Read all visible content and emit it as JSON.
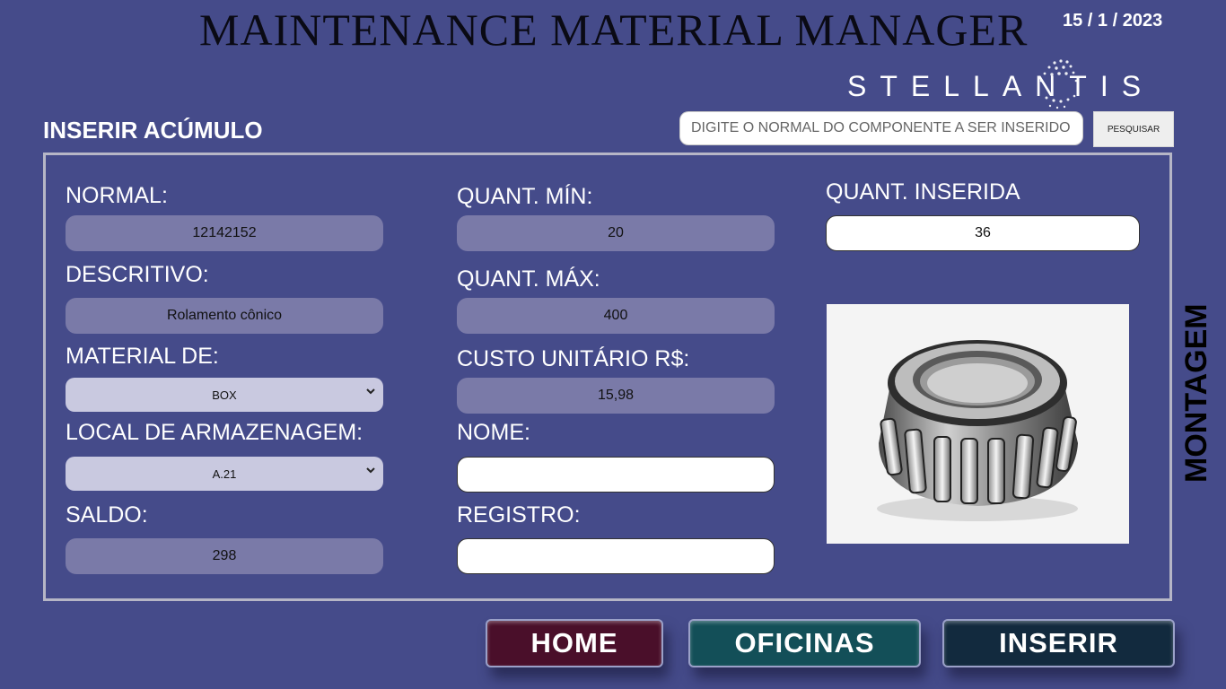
{
  "header": {
    "title": "MAINTENANCE MATERIAL MANAGER",
    "date": "15 / 1 / 2023",
    "logo_text": "STELLANTIS"
  },
  "section_title": "INSERIR ACÚMULO",
  "search": {
    "placeholder": "DIGITE O NORMAL DO COMPONENTE A SER INSERIDO",
    "button_label": "PESQUISAR"
  },
  "form": {
    "normal": {
      "label": "NORMAL:",
      "value": "12142152"
    },
    "descritivo": {
      "label": "DESCRITIVO:",
      "value": "Rolamento cônico"
    },
    "material_de": {
      "label": "MATERIAL DE:",
      "value": "BOX"
    },
    "local": {
      "label": "LOCAL DE ARMAZENAGEM:",
      "value": "A.21"
    },
    "saldo": {
      "label": "SALDO:",
      "value": "298"
    },
    "quant_min": {
      "label": "QUANT. MÍN:",
      "value": "20"
    },
    "quant_max": {
      "label": "QUANT. MÁX:",
      "value": "400"
    },
    "custo": {
      "label": "CUSTO UNITÁRIO R$:",
      "value": "15,98"
    },
    "nome": {
      "label": "NOME:",
      "value": ""
    },
    "registro": {
      "label": "REGISTRO:",
      "value": ""
    },
    "quant_inserida": {
      "label": "QUANT. INSERIDA",
      "value": "36"
    }
  },
  "side_label": "MONTAGEM",
  "buttons": {
    "home": "HOME",
    "oficinas": "OFICINAS",
    "inserir": "INSERIR"
  },
  "colors": {
    "background": "#454b8a",
    "home": "#4a0f2a",
    "oficinas": "#134f58",
    "inserir": "#122a3e"
  },
  "icons": {
    "select_chevron": "chevron-down-icon",
    "product_image": "tapered-roller-bearing"
  }
}
